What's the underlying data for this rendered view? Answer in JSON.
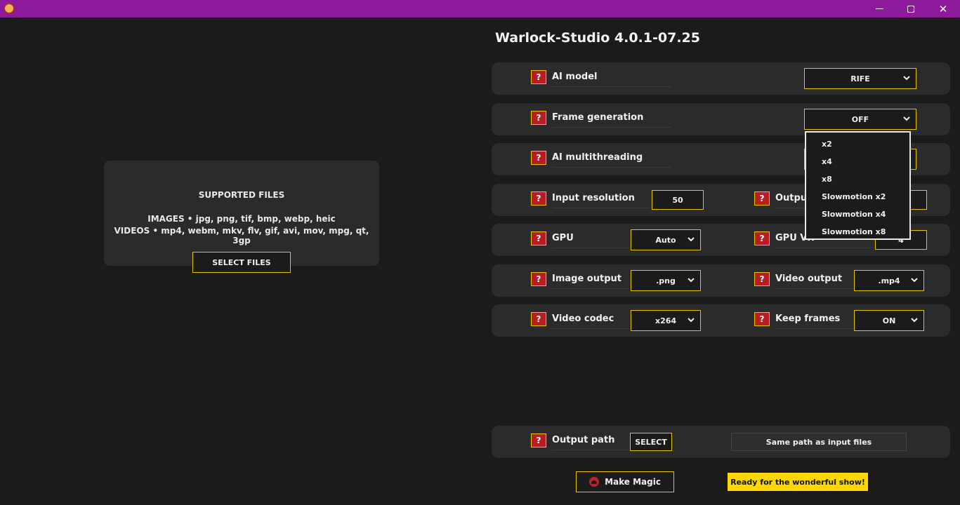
{
  "window": {
    "title_bar_color": "#8c1a9a",
    "controls": {
      "minimize": "—",
      "maximize": "",
      "close": "✕"
    }
  },
  "drop_panel": {
    "title": "SUPPORTED FILES",
    "images_line": "IMAGES • jpg, png, tif, bmp, webp, heic",
    "videos_line": "VIDEOS • mp4, webm, mkv, flv, gif, avi, mov, mpg, qt, 3gp",
    "select_button": "SELECT FILES"
  },
  "app_title": "Warlock-Studio 4.0.1-07.25",
  "help_glyph": "?",
  "settings": {
    "ai_model": {
      "label": "AI model",
      "value": "RIFE"
    },
    "frame_generation": {
      "label": "Frame generation",
      "value": "OFF"
    },
    "ai_multithreading": {
      "label": "AI multithreading"
    },
    "input_resolution": {
      "label": "Input resolution",
      "value": "50"
    },
    "output_resolution": {
      "label": "Output"
    },
    "gpu": {
      "label": "GPU",
      "value": "Auto"
    },
    "gpu_vram": {
      "label": "GPU VR",
      "value": "4"
    },
    "image_output": {
      "label": "Image output",
      "value": ".png"
    },
    "video_output": {
      "label": "Video output",
      "value": ".mp4"
    },
    "video_codec": {
      "label": "Video codec",
      "value": "x264"
    },
    "keep_frames": {
      "label": "Keep frames",
      "value": "ON"
    },
    "output_path": {
      "label": "Output path",
      "button": "SELECT",
      "value": "Same path as input files"
    }
  },
  "frame_generation_menu": {
    "options": [
      "x2",
      "x4",
      "x8",
      "Slowmotion x2",
      "Slowmotion x4",
      "Slowmotion x8"
    ]
  },
  "actions": {
    "make_magic": "Make Magic",
    "status": "Ready for the wonderful show!"
  },
  "colors": {
    "accent": "#e6c200",
    "help_red": "#b81d24",
    "status_yellow": "#ffd700",
    "panel": "#2b2b2b",
    "background": "#1b1b1b"
  },
  "icons": {
    "app": "app-logo-icon",
    "dropdown": "chevron-down-icon",
    "help": "question-icon",
    "make_magic": "magic-logo-icon"
  }
}
